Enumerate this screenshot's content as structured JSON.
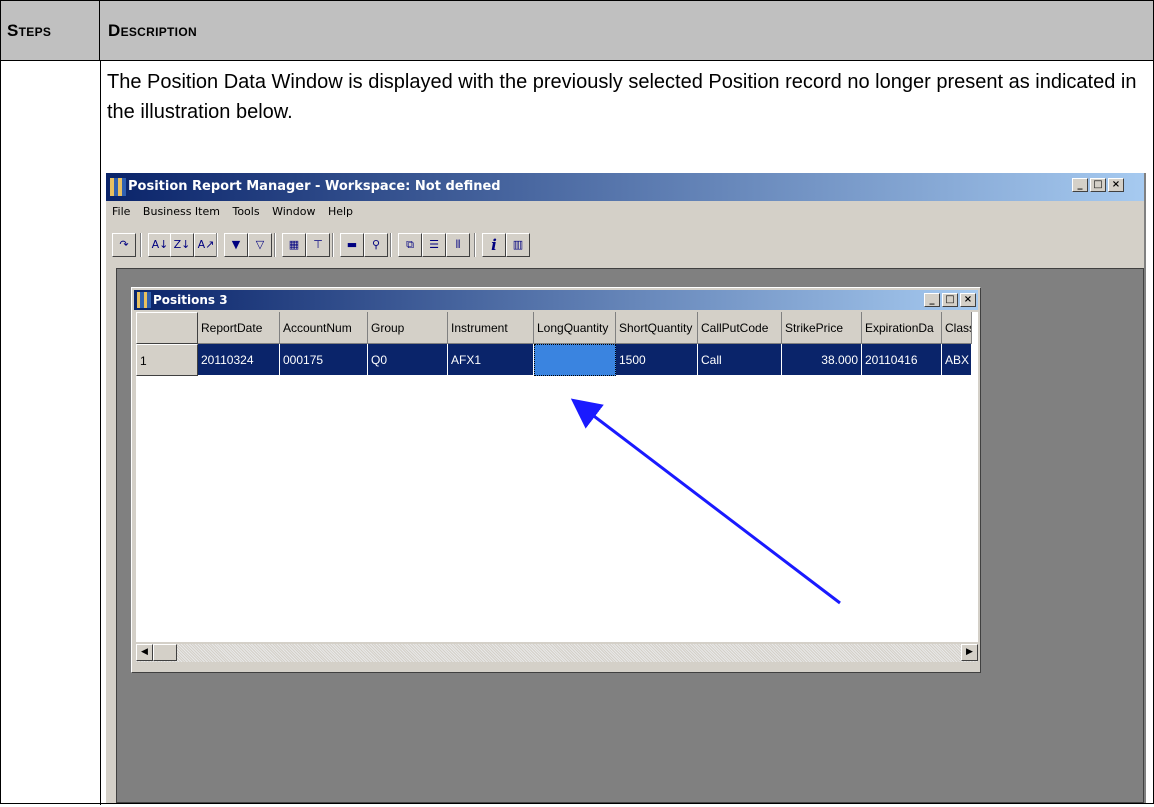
{
  "header": {
    "steps": "Steps",
    "description": "Description"
  },
  "step_text": "The Position Data Window is displayed with the previously selected Position record no longer present as indicated in the illustration below.",
  "app": {
    "title": "Position Report Manager - Workspace: Not defined",
    "menu": [
      "File",
      "Business Item",
      "Tools",
      "Window",
      "Help"
    ],
    "window_buttons": {
      "minimize": "_",
      "maximize": "□",
      "close": "×"
    },
    "toolbar": [
      {
        "icon": "refresh-icon",
        "glyph": "↷"
      },
      {
        "icon": "sort-ascending-icon",
        "glyph": "A↓"
      },
      {
        "icon": "sort-descending-icon",
        "glyph": "Z↓"
      },
      {
        "icon": "sort-custom-icon",
        "glyph": "A↗"
      },
      {
        "icon": "filter-icon",
        "glyph": "▼"
      },
      {
        "icon": "filter-clear-icon",
        "glyph": "▽"
      },
      {
        "icon": "grid-icon",
        "glyph": "▦"
      },
      {
        "icon": "tree-icon",
        "glyph": "⊤"
      },
      {
        "icon": "print-icon",
        "glyph": "▬"
      },
      {
        "icon": "find-icon",
        "glyph": "⚲"
      },
      {
        "icon": "cascade-icon",
        "glyph": "⧉"
      },
      {
        "icon": "tile-horizontal-icon",
        "glyph": "☰"
      },
      {
        "icon": "tile-vertical-icon",
        "glyph": "⫴"
      },
      {
        "icon": "info-icon",
        "glyph": "i"
      },
      {
        "icon": "columns-icon",
        "glyph": "▥"
      }
    ]
  },
  "child": {
    "title": "Positions 3",
    "columns": [
      "",
      "ReportDate",
      "AccountNum",
      "Group",
      "Instrument",
      "LongQuantity",
      "ShortQuantity",
      "CallPutCode",
      "StrikePrice",
      "ExpirationDa",
      "Class"
    ],
    "rows": [
      [
        "1",
        "20110324",
        "000175",
        "Q0",
        "AFX1",
        "",
        "1500",
        "Call",
        "38.000",
        "20110416",
        "ABX"
      ]
    ]
  }
}
